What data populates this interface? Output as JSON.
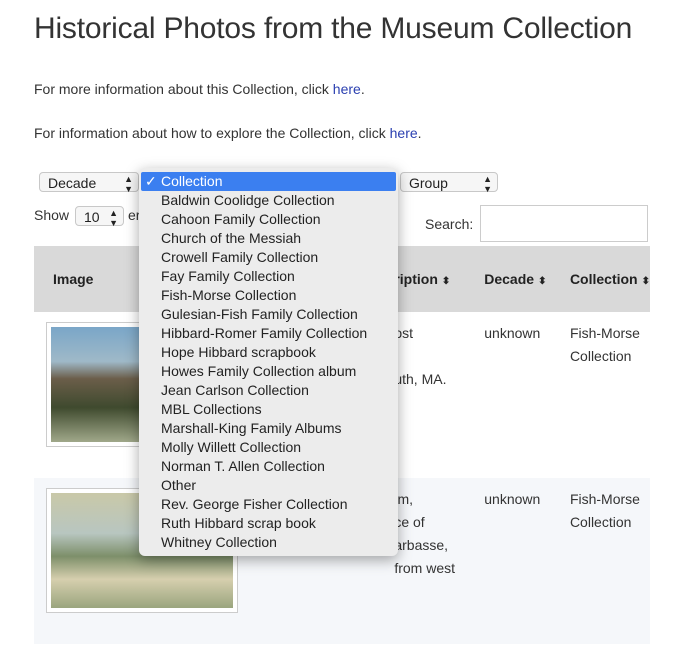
{
  "page": {
    "title": "Historical Photos from the Museum Collection",
    "info1_prefix": "For more information about this Collection, click ",
    "info1_link": "here",
    "info2_prefix": "For information about how to explore the Collection, click ",
    "info2_link": "here",
    "period": "."
  },
  "filters": {
    "decade_label": "Decade",
    "group_label": "Group",
    "show_label": "Show",
    "entries_value": "10",
    "entries_suffix": "er",
    "search_label": "Search:"
  },
  "dropdown": {
    "checkmark": "✓",
    "options": [
      "Collection",
      "Baldwin Coolidge Collection",
      "Cahoon Family Collection",
      "Church of the Messiah",
      "Crowell Family Collection",
      "Fay Family Collection",
      "Fish-Morse Collection",
      "Gulesian-Fish Family Collection",
      "Hibbard-Romer Family Collection",
      "Hope Hibbard scrapbook",
      "Howes Family Collection album",
      "Jean Carlson Collection",
      "MBL Collections",
      "Marshall-King Family Albums",
      "Molly Willett Collection",
      "Norman T. Allen Collection",
      "Other",
      "Rev. George Fisher Collection",
      "Ruth Hibbard scrap book",
      "Whitney Collection"
    ]
  },
  "table": {
    "headers": {
      "image": "Image",
      "description": "ription",
      "decade": "Decade",
      "collection": "Collection",
      "sort_icon": "⬍"
    },
    "rows": [
      {
        "desc1": "ost",
        "desc2": "",
        "desc3": "uth, MA.",
        "decade": "unknown",
        "collection1": "Fish-Morse",
        "collection2": "Collection"
      },
      {
        "desc1": "im,",
        "desc2": "ce of",
        "desc3": "arbasse,",
        "desc4": "from west",
        "decade": "unknown",
        "collection1": "Fish-Morse",
        "collection2": "Collection"
      }
    ]
  }
}
